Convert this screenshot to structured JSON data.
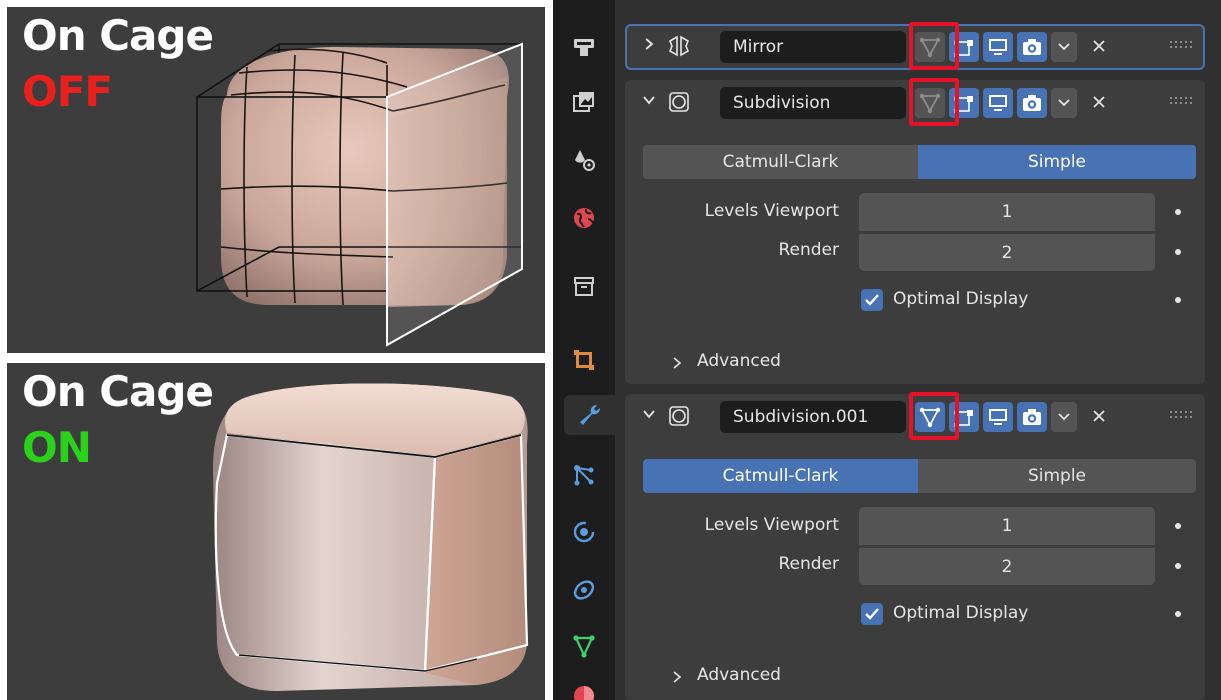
{
  "viewport_top": {
    "line1": "On Cage",
    "line2": "OFF",
    "line2_color": "#e8211d"
  },
  "viewport_bottom": {
    "line1": "On Cage",
    "line2": "ON",
    "line2_color": "#2bd21b"
  },
  "property_tabs": [
    {
      "icon": "tool-icon"
    },
    {
      "icon": "render-icon"
    },
    {
      "icon": "output-icon"
    },
    {
      "icon": "view-layer-icon"
    },
    {
      "icon": "scene-icon"
    },
    {
      "icon": "world-icon"
    },
    {
      "icon": "collection-icon"
    },
    {
      "icon": "object-icon"
    },
    {
      "icon": "modifier-wrench-icon",
      "active": true
    },
    {
      "icon": "particles-icon"
    },
    {
      "icon": "physics-icon"
    },
    {
      "icon": "constraints-icon"
    },
    {
      "icon": "mesh-data-icon"
    },
    {
      "icon": "material-icon"
    }
  ],
  "modifiers": [
    {
      "name": "Mirror",
      "collapsed": true,
      "type_icon": "mirror-modifier-icon",
      "on_cage": false
    },
    {
      "name": "Subdivision",
      "collapsed": false,
      "type_icon": "subdivision-modifier-icon",
      "on_cage": false,
      "algorithm": {
        "options": [
          "Catmull-Clark",
          "Simple"
        ],
        "selected": "Simple"
      },
      "levels_viewport": {
        "label": "Levels Viewport",
        "value": "1"
      },
      "render": {
        "label": "Render",
        "value": "2"
      },
      "optimal_display": {
        "label": "Optimal Display",
        "checked": true
      },
      "advanced": {
        "label": "Advanced"
      }
    },
    {
      "name": "Subdivision.001",
      "collapsed": false,
      "type_icon": "subdivision-modifier-icon",
      "on_cage": true,
      "algorithm": {
        "options": [
          "Catmull-Clark",
          "Simple"
        ],
        "selected": "Catmull-Clark"
      },
      "levels_viewport": {
        "label": "Levels Viewport",
        "value": "1"
      },
      "render": {
        "label": "Render",
        "value": "2"
      },
      "optimal_display": {
        "label": "Optimal Display",
        "checked": true
      },
      "advanced": {
        "label": "Advanced"
      }
    }
  ],
  "colors": {
    "accent_blue": "#4772b3",
    "highlight_red": "#e8112a",
    "panel_bg": "#3d3d3d",
    "on_cage_active_icon": "#4772b3"
  }
}
